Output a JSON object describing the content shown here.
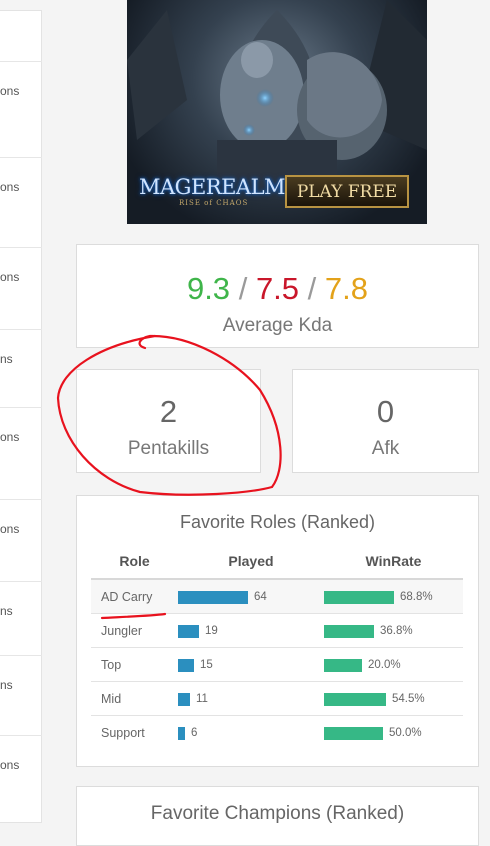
{
  "left_column": {
    "row_label": "ons",
    "partial_row_label": "ns"
  },
  "ad": {
    "brand": "MAGEREALM",
    "tagline": "RISE of CHAOS",
    "cta": "PLAY FREE"
  },
  "kda": {
    "kills": "9.3",
    "deaths": "7.5",
    "assists": "7.8",
    "separator": "/",
    "label": "Average Kda"
  },
  "pentakills": {
    "value": "2",
    "label": "Pentakills"
  },
  "afk": {
    "value": "0",
    "label": "Afk"
  },
  "roles": {
    "title": "Favorite Roles (Ranked)",
    "headers": [
      "Role",
      "Played",
      "WinRate"
    ],
    "rows": [
      {
        "role": "AD Carry",
        "played": 64,
        "winrate": "68.8%",
        "winrate_value": 68.8
      },
      {
        "role": "Jungler",
        "played": 19,
        "winrate": "36.8%",
        "winrate_value": 36.8
      },
      {
        "role": "Top",
        "played": 15,
        "winrate": "20.0%",
        "winrate_value": 20.0
      },
      {
        "role": "Mid",
        "played": 11,
        "winrate": "54.5%",
        "winrate_value": 54.5
      },
      {
        "role": "Support",
        "played": 6,
        "winrate": "50.0%",
        "winrate_value": 50.0
      }
    ]
  },
  "champions": {
    "title": "Favorite Champions (Ranked)"
  },
  "colors": {
    "green": "#3fb54a",
    "red": "#c9162a",
    "orange": "#e3a21a",
    "played_bar": "#2b8fbf",
    "winrate_bar": "#36b886",
    "annotation": "#e8121e"
  }
}
